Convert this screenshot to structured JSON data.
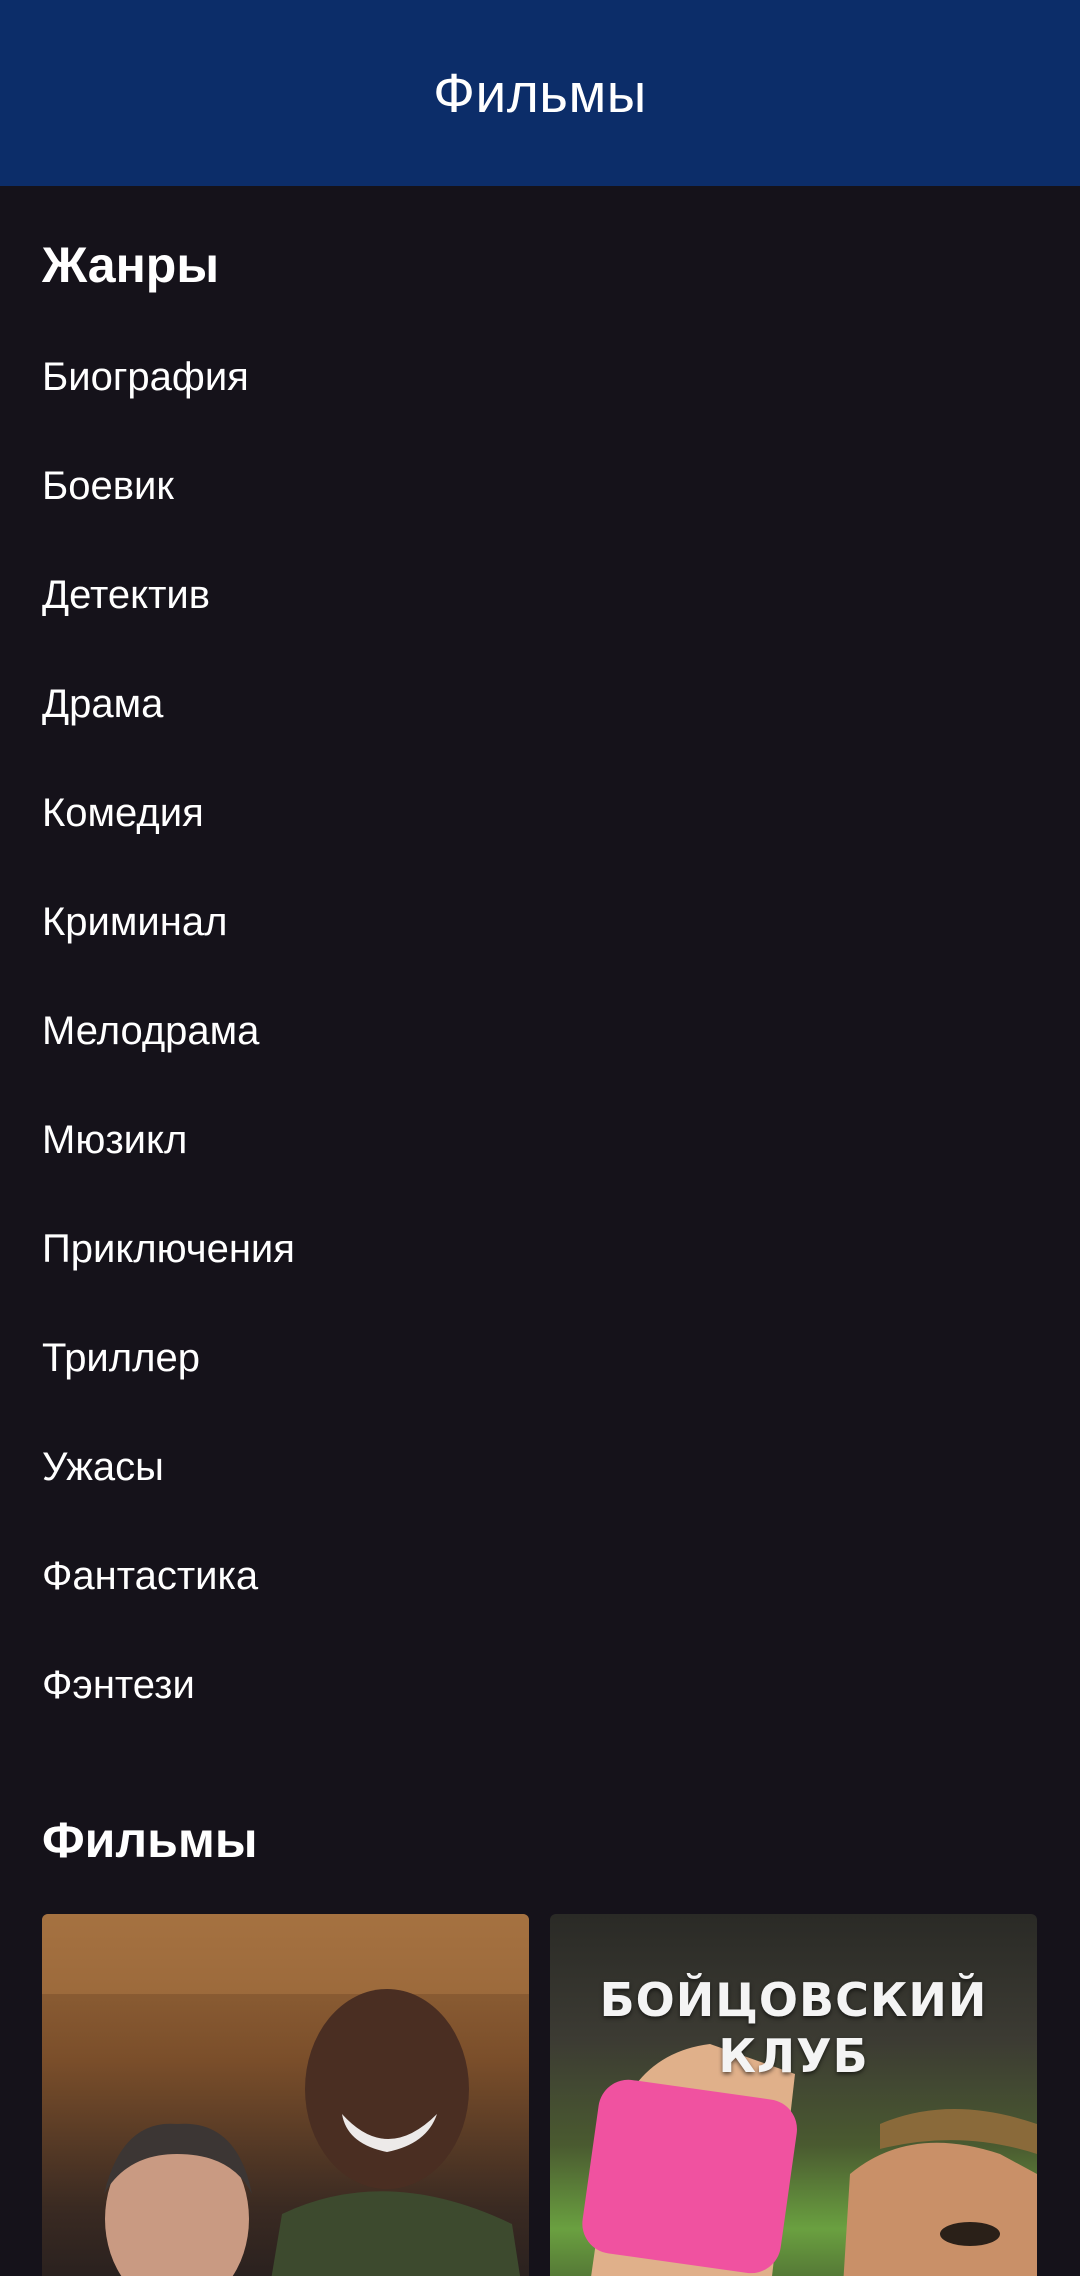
{
  "app_bar": {
    "title": "Фильмы"
  },
  "genres": {
    "heading": "Жанры",
    "items": [
      "Биография",
      "Боевик",
      "Детектив",
      "Драма",
      "Комедия",
      "Криминал",
      "Мелодрама",
      "Мюзикл",
      "Приключения",
      "Триллер",
      "Ужасы",
      "Фантастика",
      "Фэнтези"
    ]
  },
  "films": {
    "heading": "Фильмы",
    "posters": [
      {
        "caption": ""
      },
      {
        "caption": "БОЙЦОВСКИЙ\nКЛУБ"
      }
    ]
  },
  "colors": {
    "app_bar": "#0c2d69",
    "background": "#15121a",
    "text": "#ffffff"
  }
}
